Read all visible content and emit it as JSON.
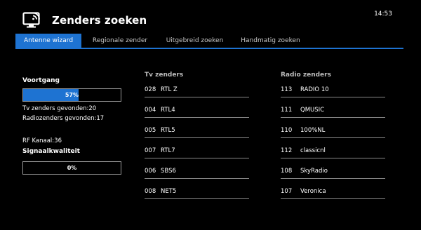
{
  "header": {
    "icon": "tv-wireless-icon",
    "title": "Zenders zoeken",
    "time": "14:53"
  },
  "tabs": [
    {
      "label": "Antenne wizard",
      "active": true
    },
    {
      "label": "Regionale zender",
      "active": false
    },
    {
      "label": "Uitgebreid zoeken",
      "active": false
    },
    {
      "label": "Handmatig zoeken",
      "active": false
    }
  ],
  "progress": {
    "label": "Voortgang",
    "value": 0.57,
    "text": "57%"
  },
  "counts": {
    "tv_found": "Tv zenders gevonden:20",
    "radio_found": "Radiozenders gevonden:17"
  },
  "rf_channel": "RF Kanaal:36",
  "signal": {
    "label": "Signaalkwaliteit",
    "value": 0,
    "text": "0%"
  },
  "tv_list": {
    "header": "Tv zenders",
    "items": [
      {
        "num": "028",
        "name": "RTL Z"
      },
      {
        "num": "004",
        "name": "RTL4"
      },
      {
        "num": "005",
        "name": "RTL5"
      },
      {
        "num": "007",
        "name": "RTL7"
      },
      {
        "num": "006",
        "name": "SBS6"
      },
      {
        "num": "008",
        "name": "NET5"
      }
    ]
  },
  "radio_list": {
    "header": "Radio zenders",
    "items": [
      {
        "num": "113",
        "name": "RADIO 10"
      },
      {
        "num": "111",
        "name": "QMUSIC"
      },
      {
        "num": "110",
        "name": "100%NL"
      },
      {
        "num": "112",
        "name": "classicnl"
      },
      {
        "num": "108",
        "name": "SkyRadio"
      },
      {
        "num": "107",
        "name": "Veronica"
      }
    ]
  },
  "colors": {
    "accent": "#1e73d2",
    "background": "#000000"
  }
}
